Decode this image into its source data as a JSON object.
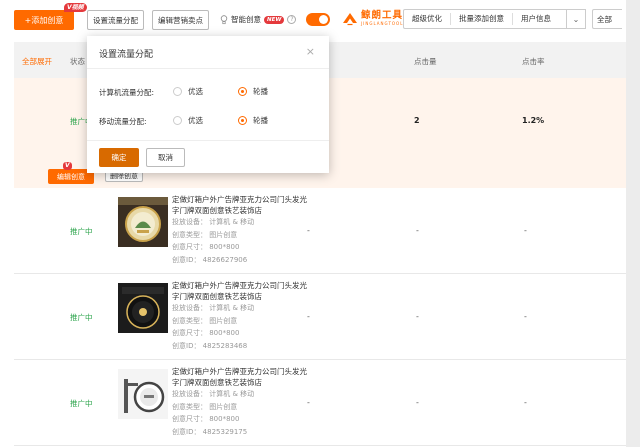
{
  "toolbar": {
    "add_label": "+添加创意",
    "video_badge": "V视频",
    "traffic_label": "设置流量分配",
    "selling_label": "编辑营销卖点",
    "smart_label": "智能创意",
    "new_badge": "NEW",
    "toggle_on": true,
    "logo_main": "鲸朗工具",
    "logo_sub": "JINGLANGTOOL",
    "tabs": [
      "超级优化",
      "批量添加创意",
      "用户信息"
    ],
    "all_label": "全部",
    "accent": "#ff6a00"
  },
  "table": {
    "expand_all": "全部展开",
    "col_status": "状态",
    "col_clicks": "点击量",
    "col_ctr": "点击率"
  },
  "group": {
    "status": "推广中",
    "clicks": "2",
    "ctr": "1.2%",
    "edit_label": "编辑创意",
    "delete_label": "删除创意",
    "edit_badge": "V"
  },
  "creatives": [
    {
      "status": "推广中",
      "title": "定做灯箱户外广告牌亚克力公司门头发光字门牌双面创意铁艺装饰店",
      "device": "投放设备： 计算机 & 移动",
      "type": "创意类型： 图片创意",
      "size": "创意尺寸： 800*800",
      "id": "创意ID： 4826627906",
      "dash1": "-",
      "dash2": "-",
      "dash3": "-"
    },
    {
      "status": "推广中",
      "title": "定做灯箱户外广告牌亚克力公司门头发光字门牌双面创意铁艺装饰店",
      "device": "投放设备： 计算机 & 移动",
      "type": "创意类型： 图片创意",
      "size": "创意尺寸： 800*800",
      "id": "创意ID： 4825283468",
      "dash1": "-",
      "dash2": "-",
      "dash3": "-"
    },
    {
      "status": "推广中",
      "title": "定做灯箱户外广告牌亚克力公司门头发光字门牌双面创意铁艺装饰店",
      "device": "投放设备： 计算机 & 移动",
      "type": "创意类型： 图片创意",
      "size": "创意尺寸： 800*800",
      "id": "创意ID： 4825329175",
      "dash1": "-",
      "dash2": "-",
      "dash3": "-"
    }
  ],
  "modal": {
    "title": "设置流量分配",
    "close": "×",
    "pc_label": "计算机流量分配:",
    "mobile_label": "移动流量分配:",
    "opt_best": "优选",
    "opt_rotate": "轮播",
    "pc_selected": "轮播",
    "mobile_selected": "轮播",
    "ok_label": "确定",
    "cancel_label": "取消"
  }
}
